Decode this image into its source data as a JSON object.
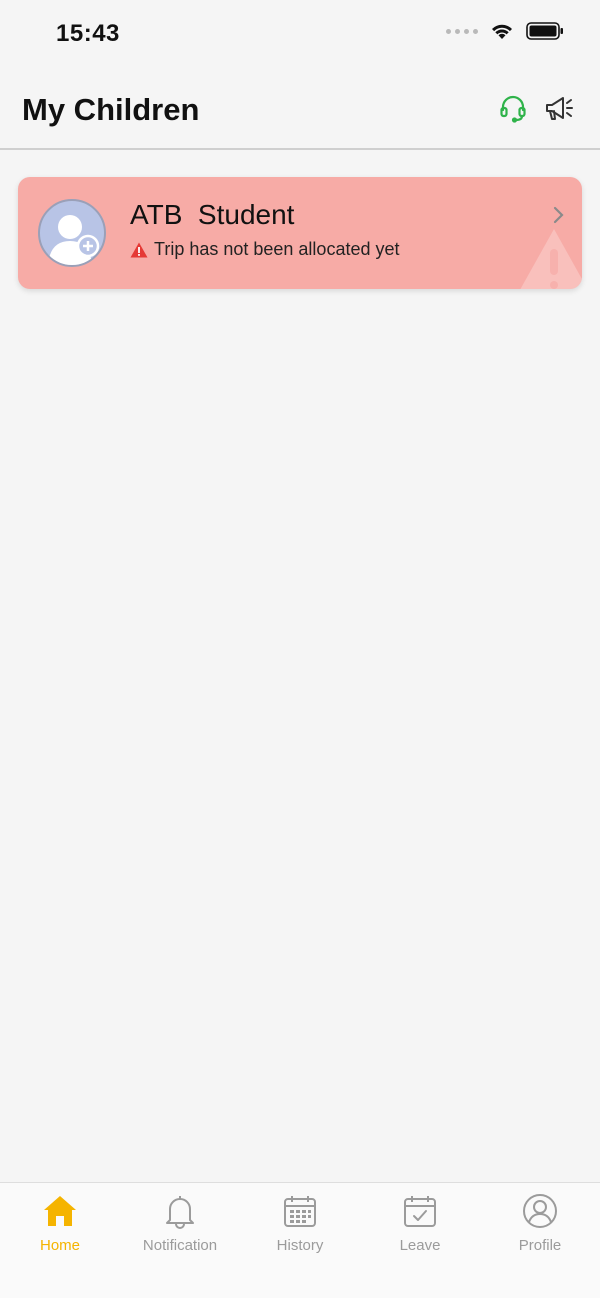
{
  "status_bar": {
    "time": "15:43"
  },
  "header": {
    "title": "My Children"
  },
  "children": [
    {
      "name": "ATB  Student",
      "trip_status": "Trip has not been allocated yet"
    }
  ],
  "nav": {
    "items": [
      {
        "label": "Home",
        "icon": "home-icon",
        "active": true
      },
      {
        "label": "Notification",
        "icon": "bell-icon",
        "active": false
      },
      {
        "label": "History",
        "icon": "calendar-grid-icon",
        "active": false
      },
      {
        "label": "Leave",
        "icon": "calendar-check-icon",
        "active": false
      },
      {
        "label": "Profile",
        "icon": "user-circle-icon",
        "active": false
      }
    ]
  },
  "colors": {
    "accent": "#f5b400",
    "support_icon": "#2fb34a",
    "card_background": "#f7aba6",
    "warning": "#e53935",
    "inactive": "#9b9b9b"
  }
}
